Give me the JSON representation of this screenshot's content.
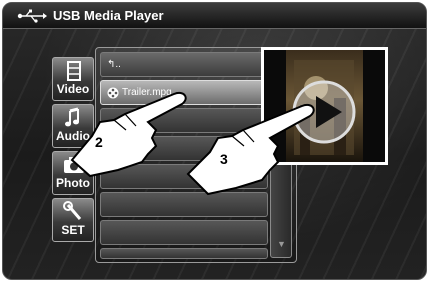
{
  "app": {
    "title": "USB Media Player",
    "usb_icon": "usb-icon"
  },
  "sidebar": {
    "items": [
      {
        "label": "Video",
        "icon": "film-icon"
      },
      {
        "label": "Audio",
        "icon": "music-note-icon"
      },
      {
        "label": "Photo",
        "icon": "camera-icon"
      },
      {
        "label": "SET",
        "icon": "wrench-icon"
      }
    ]
  },
  "file_list": {
    "rows": [
      {
        "label": "↰..",
        "type": "parent-folder",
        "selected": false
      },
      {
        "label": "Trailer.mpg",
        "type": "video-file",
        "icon": "film-reel-icon",
        "selected": true
      },
      {
        "label": "",
        "type": "empty"
      },
      {
        "label": "",
        "type": "empty"
      },
      {
        "label": "",
        "type": "empty"
      },
      {
        "label": "",
        "type": "empty"
      },
      {
        "label": "",
        "type": "empty"
      },
      {
        "label": "",
        "type": "empty"
      }
    ],
    "scroll_down_icon": "triangle-down-icon"
  },
  "preview": {
    "play_icon": "play-icon"
  },
  "callouts": [
    {
      "number": "2",
      "target": "Trailer.mpg",
      "icon": "pointing-hand-icon"
    },
    {
      "number": "3",
      "target": "preview",
      "icon": "pointing-hand-icon"
    }
  ]
}
